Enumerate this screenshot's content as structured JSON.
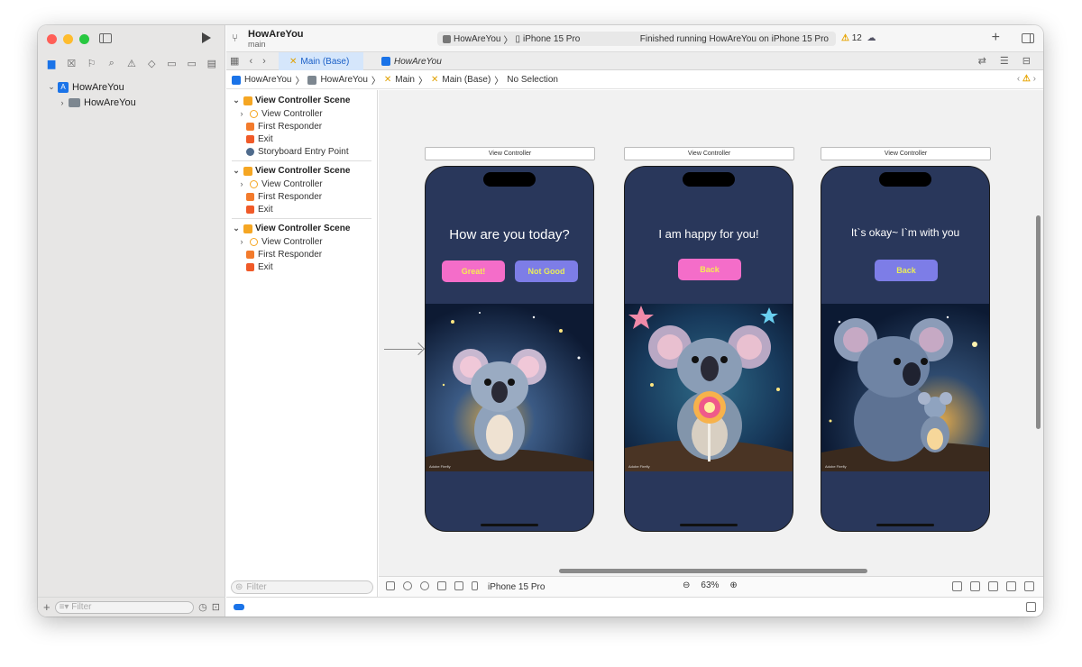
{
  "toolbar": {
    "project_title": "HowAreYou",
    "branch": "main",
    "scheme_project": "HowAreYou",
    "scheme_sep": "〉",
    "scheme_device": "iPhone 15 Pro",
    "status": "Finished running HowAreYou on iPhone 15 Pro",
    "warning_count": "12"
  },
  "navigator": {
    "project": "HowAreYou",
    "folder": "HowAreYou",
    "filter_placeholder": "Filter"
  },
  "tabs": [
    {
      "label": "Main (Base)"
    },
    {
      "label": "HowAreYou"
    }
  ],
  "jumpbar": {
    "items": [
      "HowAreYou",
      "HowAreYou",
      "Main",
      "Main (Base)",
      "No Selection"
    ],
    "sep": "〉"
  },
  "outline": {
    "scenes": [
      {
        "title": "View Controller Scene",
        "items": [
          "View Controller",
          "First Responder",
          "Exit",
          "Storyboard Entry Point"
        ]
      },
      {
        "title": "View Controller Scene",
        "items": [
          "View Controller",
          "First Responder",
          "Exit"
        ]
      },
      {
        "title": "View Controller Scene",
        "items": [
          "View Controller",
          "First Responder",
          "Exit"
        ]
      }
    ],
    "filter_placeholder": "Filter"
  },
  "canvas": {
    "vc_label": "View Controller",
    "screens": [
      {
        "title": "How are you today?",
        "buttons": [
          "Great!",
          "Not Good"
        ]
      },
      {
        "title": "I am happy for you!",
        "buttons": [
          "Back"
        ]
      },
      {
        "title": "It`s okay~ I`m with you",
        "buttons": [
          "Back"
        ]
      }
    ],
    "watermark": "Adobe Firefly"
  },
  "canvas_bar": {
    "device": "iPhone 15 Pro",
    "zoom": "63%"
  },
  "colors": {
    "phone_bg": "#29375b",
    "pink_button": "#f46dc9",
    "purple_button": "#7d7de7",
    "button_text": "#f7ec54",
    "accent": "#1a73e8"
  }
}
